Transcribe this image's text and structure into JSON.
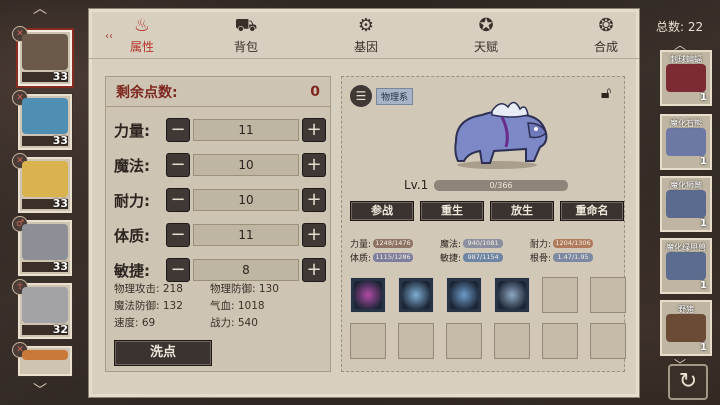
{
  "tabs": [
    {
      "label": "属性",
      "icon": "flame-icon",
      "active": true
    },
    {
      "label": "背包",
      "icon": "backpack-icon",
      "active": false
    },
    {
      "label": "基因",
      "icon": "gene-icon",
      "active": false
    },
    {
      "label": "天赋",
      "icon": "talent-icon",
      "active": false
    },
    {
      "label": "合成",
      "icon": "craft-icon",
      "active": false
    }
  ],
  "heroes": [
    {
      "level": "33",
      "active": true,
      "badge": "✕",
      "color": "#6b5a4a"
    },
    {
      "level": "33",
      "active": false,
      "badge": "✕",
      "color": "#4f8fb3"
    },
    {
      "level": "33",
      "active": false,
      "badge": "✕",
      "color": "#d9b34e"
    },
    {
      "level": "33",
      "active": false,
      "badge": "♂",
      "color": "#8c8f96"
    },
    {
      "level": "32",
      "active": false,
      "badge": "☥",
      "color": "#a3a2a7"
    },
    {
      "level": "",
      "active": false,
      "badge": "✕",
      "color": "#c97a3b"
    }
  ],
  "stats": {
    "remaining_label": "剩余点数:",
    "remaining_value": "0",
    "attributes": [
      {
        "label": "力量:",
        "value": "11"
      },
      {
        "label": "魔法:",
        "value": "10"
      },
      {
        "label": "耐力:",
        "value": "10"
      },
      {
        "label": "体质:",
        "value": "11"
      },
      {
        "label": "敏捷:",
        "value": "8"
      }
    ],
    "derived": [
      {
        "text": "物理攻击: 218"
      },
      {
        "text": "物理防御: 130"
      },
      {
        "text": "魔法防御: 132"
      },
      {
        "text": "气血: 1018"
      },
      {
        "text": "速度: 69"
      },
      {
        "text": "战力: 540"
      }
    ],
    "wash_label": "洗点"
  },
  "pet": {
    "type_label": "物理系",
    "level": "Lv.1",
    "exp_text": "0/366",
    "exp_fraction": 0.0,
    "actions": [
      "参战",
      "重生",
      "放生",
      "重命名"
    ],
    "stats": [
      {
        "label": "力量:",
        "value": "1248/1476",
        "color": "#8f7466",
        "fill": 0.85
      },
      {
        "label": "魔法:",
        "value": "940/1081",
        "color": "#8b8fa0",
        "fill": 0.87
      },
      {
        "label": "耐力:",
        "value": "1204/1306",
        "color": "#b07a5c",
        "fill": 0.92
      },
      {
        "label": "体质:",
        "value": "1115/1286",
        "color": "#7d7e9d",
        "fill": 0.87
      },
      {
        "label": "敏捷:",
        "value": "987/1154",
        "color": "#6e86a6",
        "fill": 0.86
      },
      {
        "label": "根骨:",
        "value": "1.47/1.95",
        "color": "#7d89a4",
        "fill": 0.75
      }
    ],
    "skills": [
      {
        "filled": true,
        "color": "#b14aa6"
      },
      {
        "filled": true,
        "color": "#7eaed3"
      },
      {
        "filled": true,
        "color": "#6c9bc9"
      },
      {
        "filled": true,
        "color": "#8ea6c1"
      },
      {
        "filled": false
      },
      {
        "filled": false
      },
      {
        "filled": false
      },
      {
        "filled": false
      },
      {
        "filled": false
      },
      {
        "filled": false
      },
      {
        "filled": false
      },
      {
        "filled": false
      }
    ]
  },
  "pets_col": {
    "total_label": "总数: 22",
    "pets": [
      {
        "name": "刺球蝙蝠",
        "level": "1",
        "color": "#7c2a33"
      },
      {
        "name": "魔化石熊",
        "level": "1",
        "color": "#6d78a5"
      },
      {
        "name": "魔化狮鹫",
        "level": "1",
        "color": "#5b6a8f"
      },
      {
        "name": "魔化绿甲兽",
        "level": "1",
        "color": "#5b6c8e"
      },
      {
        "name": "野猪",
        "level": "1",
        "color": "#6b4a36"
      }
    ]
  },
  "colors": {
    "accent": "#b7332a",
    "panel": "#d7cfc0",
    "button": "#3a3330"
  }
}
